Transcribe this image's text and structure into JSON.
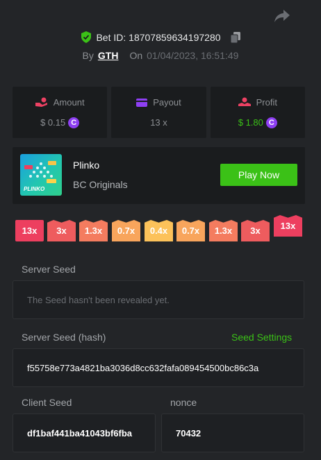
{
  "header": {
    "bet_id": "Bet ID: 18707859634197280",
    "by_label": "By",
    "user": "GTH",
    "on_label": "On",
    "date": "01/04/2023, 16:51:49"
  },
  "stats": [
    {
      "label": "Amount",
      "value": "$ 0.15",
      "icon": "hand-coin-icon",
      "color": "#ed4163"
    },
    {
      "label": "Payout",
      "value": "13 x",
      "icon": "wallet-icon",
      "color": "#8e3ff3"
    },
    {
      "label": "Profit",
      "value": "$ 1.80",
      "icon": "profit-icon",
      "color": "#ed4163"
    }
  ],
  "game": {
    "name": "Plinko",
    "provider": "BC Originals",
    "play_label": "Play Now",
    "thumb_label": "PLINKO"
  },
  "multipliers": [
    {
      "label": "13x",
      "color": "#ed3f5f"
    },
    {
      "label": "3x",
      "color": "#ee5c5e"
    },
    {
      "label": "1.3x",
      "color": "#f47c5f"
    },
    {
      "label": "0.7x",
      "color": "#f8a55c"
    },
    {
      "label": "0.4x",
      "color": "#fcc25a"
    },
    {
      "label": "0.7x",
      "color": "#f8a55c"
    },
    {
      "label": "1.3x",
      "color": "#f47c5f"
    },
    {
      "label": "3x",
      "color": "#ee5c5e"
    },
    {
      "label": "13x",
      "color": "#ed3f5f"
    }
  ],
  "server_seed": {
    "label": "Server Seed",
    "value": "The Seed hasn't been revealed yet."
  },
  "server_seed_hash": {
    "label": "Server Seed (hash)",
    "settings_label": "Seed Settings",
    "value": "f55758e773a4821ba3036d8cc632fafa089454500bc86c3a"
  },
  "client_seed": {
    "label": "Client Seed",
    "value": "df1baf441ba41043bf6fba"
  },
  "nonce": {
    "label": "nonce",
    "value": "70432"
  },
  "coin_symbol": "C",
  "accent_green": "#3bc117"
}
